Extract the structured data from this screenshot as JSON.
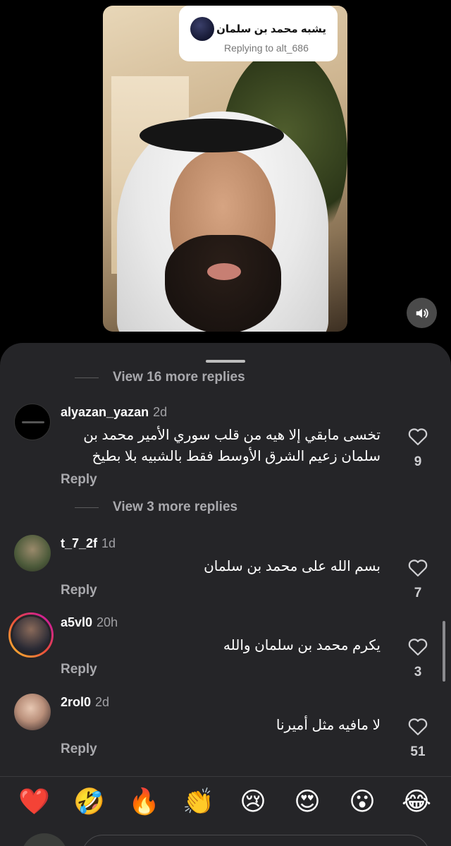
{
  "video": {
    "reply_to_name": "يشبه محمد بن سلمان",
    "reply_to_sub": "Replying to alt_686",
    "sound_icon": "speaker-icon"
  },
  "comments_sheet": {
    "view_more_top": "View 16 more replies",
    "view_more_mid": "View 3 more replies",
    "reply_label": "Reply",
    "comments": [
      {
        "username": "alyazan_yazan",
        "age": "2d",
        "text_line1": "تخسى مابقي إلا هيه من قلب سوري الأمير محمد بن",
        "text_line2": "سلمان زعيم الشرق الأوسط فقط بالشبيه بلا بطيخ",
        "likes": "9"
      },
      {
        "username": "t_7_2f",
        "age": "1d",
        "text_line1": "بسم الله على محمد بن سلمان",
        "likes": "7"
      },
      {
        "username": "a5vl0",
        "age": "20h",
        "text_line1": "يكرم محمد بن سلمان والله",
        "likes": "3"
      },
      {
        "username": "2rol0",
        "age": "2d",
        "text_line1": "لا مافيه مثل أميرنا",
        "likes": "51"
      }
    ]
  },
  "reactions": [
    "❤️",
    "🤣",
    "🔥",
    "👏",
    "😢",
    "😍",
    "😮",
    "😂"
  ],
  "colors": {
    "sheet_bg": "#252528",
    "secondary_text": "#a9a9ad",
    "story_ring_start": "#f9c22e",
    "story_ring_end": "#c40fb5"
  }
}
